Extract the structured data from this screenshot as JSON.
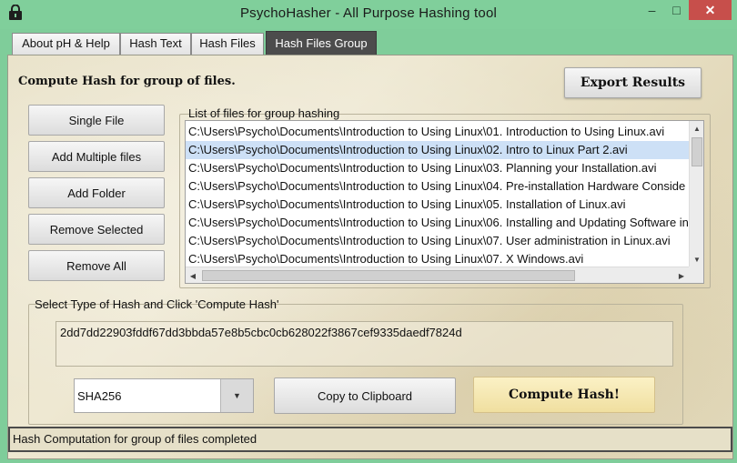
{
  "window": {
    "title": "PsychoHasher - All Purpose Hashing tool",
    "icon": "lock-icon",
    "min_glyph": "–",
    "max_glyph": "□",
    "close_glyph": "✕"
  },
  "tabs": [
    {
      "label": "About pH & Help"
    },
    {
      "label": "Hash Text"
    },
    {
      "label": "Hash Files"
    },
    {
      "label": "Hash Files Group",
      "active": true
    }
  ],
  "main": {
    "heading": "Compute Hash for group of files.",
    "export_label": "Export Results",
    "buttons": {
      "single_file": "Single File",
      "add_multiple": "Add Multiple files",
      "add_folder": "Add Folder",
      "remove_selected": "Remove Selected",
      "remove_all": "Remove All"
    },
    "file_list": {
      "label": "List of files for group hashing",
      "items": [
        "C:\\Users\\Psycho\\Documents\\Introduction to Using Linux\\01. Introduction to Using Linux.avi",
        "C:\\Users\\Psycho\\Documents\\Introduction to Using Linux\\02. Intro to Linux Part 2.avi",
        "C:\\Users\\Psycho\\Documents\\Introduction to Using Linux\\03. Planning your Installation.avi",
        "C:\\Users\\Psycho\\Documents\\Introduction to Using Linux\\04. Pre-installation Hardware Conside",
        "C:\\Users\\Psycho\\Documents\\Introduction to Using Linux\\05. Installation of Linux.avi",
        "C:\\Users\\Psycho\\Documents\\Introduction to Using Linux\\06. Installing and Updating Software in",
        "C:\\Users\\Psycho\\Documents\\Introduction to Using Linux\\07. User administration in Linux.avi",
        "C:\\Users\\Psycho\\Documents\\Introduction to Using Linux\\07. X Windows.avi"
      ],
      "selected_index": 1
    },
    "hash": {
      "group_label": "Select Type of Hash and Click 'Compute Hash'",
      "output": "2dd7dd22903fddf67dd3bbda57e8b5cbc0cb628022f3867cef9335daedf7824d",
      "algorithm": "SHA256",
      "copy_label": "Copy to Clipboard",
      "compute_label": "Compute Hash!"
    }
  },
  "status": {
    "text": "Hash Computation for group of files completed"
  },
  "colors": {
    "window_chrome": "#7fcd9a",
    "close_button": "#c74f4b",
    "active_tab": "#4c4c4c",
    "selection": "#cde0f6",
    "compute_button": "#f5e6ad"
  }
}
